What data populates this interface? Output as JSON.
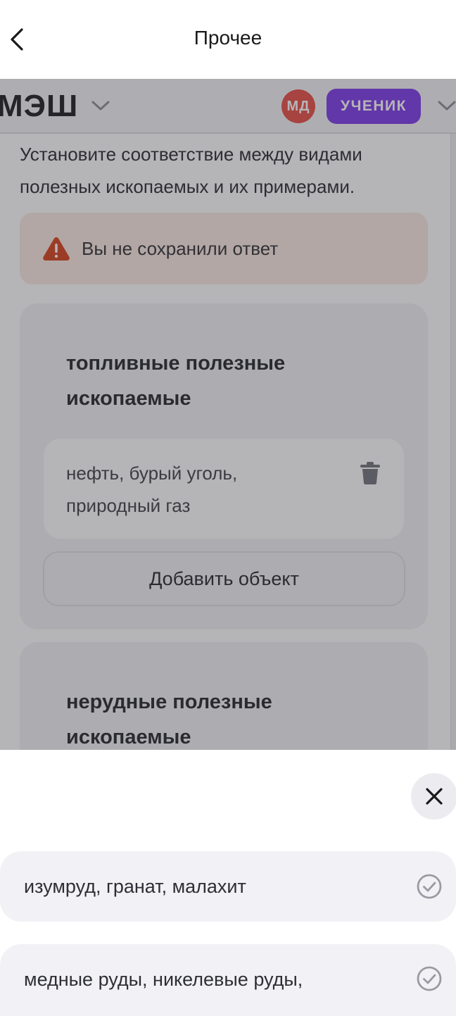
{
  "topbar": {
    "title": "Прочее",
    "back_icon": "chevron-left-icon"
  },
  "site_header": {
    "logo": "МЭШ",
    "avatar_initials": "МД",
    "role_badge": "УЧЕНИК"
  },
  "task": {
    "question": "Установите соответствие между видами полезных ископаемых и их примерами.",
    "alert": "Вы не сохранили ответ"
  },
  "groups": [
    {
      "title": "топливные полезные ископаемые",
      "items": [
        "нефть, бурый уголь, природный газ"
      ],
      "add_label": "Добавить объект"
    },
    {
      "title": "нерудные полезные ископаемые"
    }
  ],
  "sheet": {
    "options": [
      "изумруд, гранат, малахит",
      "медные руды, никелевые руды,"
    ]
  },
  "colors": {
    "role_badge": "#7a35e8",
    "avatar": "#e8473f",
    "alert_bg": "#fbe9e1",
    "alert_icon": "#d63c15"
  }
}
